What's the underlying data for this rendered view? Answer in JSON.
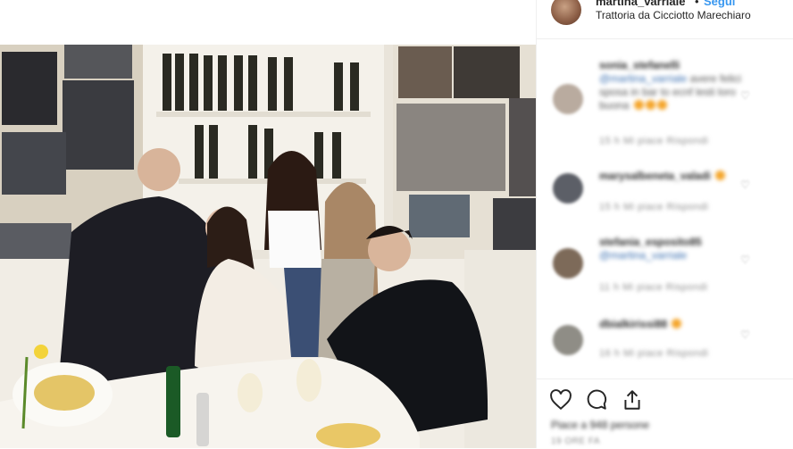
{
  "post": {
    "username": "martina_varriale",
    "separator": "•",
    "follow_label": "Segui",
    "location": "Trattoria da Cicciotto Marechiaro"
  },
  "comments": [
    {
      "user": "sonia_stefanelli",
      "mention": "@martina_varriale",
      "text": "avere felici sposa in bar to ecnf lesti loro buona",
      "emoji_count": 3,
      "meta": "15 h   Mi piace   Rispondi",
      "avatar_color": "#b9ab9f"
    },
    {
      "user": "marysalbeneta_valadi",
      "mention": "",
      "text": "",
      "emoji_count": 1,
      "meta": "15 h   Mi piace   Rispondi",
      "avatar_color": "#5c5f67"
    },
    {
      "user": "stefania_esposito85",
      "mention": "@martina_varriale",
      "text": "",
      "emoji_count": 0,
      "meta": "11 h   Mi piace   Rispondi",
      "avatar_color": "#7d6a59"
    },
    {
      "user": "dbialkirissi88",
      "mention": "",
      "text": "",
      "emoji_count": 1,
      "meta": "16 h   Mi piace   Rispondi",
      "avatar_color": "#8f8d86"
    }
  ],
  "footer": {
    "likes": "Piace a 948 persone",
    "date": "19 ORE FA"
  },
  "colors": {
    "follow_blue": "#3897f0",
    "divider": "#efefef"
  },
  "icons": [
    "heart-icon",
    "comment-icon",
    "share-icon"
  ]
}
